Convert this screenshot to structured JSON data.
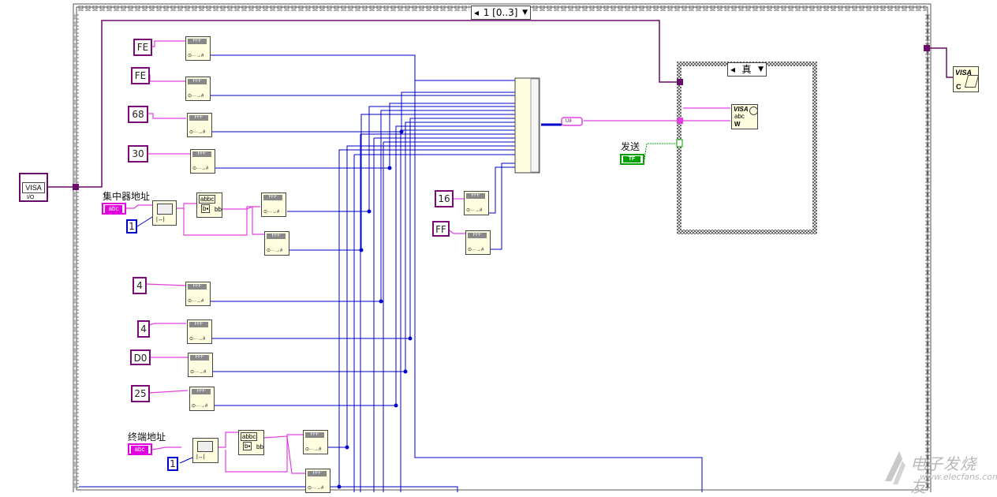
{
  "sequence_selector": {
    "label": "1 [0..3]",
    "arrow": "▼"
  },
  "case_selector": {
    "label": "真",
    "arrow": "▼"
  },
  "labels": {
    "concentrator_address": "集中器地址",
    "terminal_address": "终端地址",
    "send": "发送"
  },
  "string_constants": [
    "FE",
    "FE",
    "68",
    "30",
    "4",
    "4",
    "D0",
    "25",
    "16",
    "FF"
  ],
  "numeric_constants": [
    "1",
    "1"
  ],
  "string_controls": [
    "abc",
    "abc"
  ],
  "visa": {
    "in_label": "VISA",
    "in_sub": "I/O",
    "write_label": "VISA",
    "write_sub": "abc",
    "write_w": "W",
    "close_label": "VISA",
    "close_c": "C"
  },
  "boolean_indicator": {
    "label": "TF"
  },
  "conversion": {
    "u8_label": "U8"
  },
  "node_text": {
    "fmt_top": "FFF",
    "fmt_bottom": "⊙···→#"
  },
  "colors": {
    "wire_visa": "#6a0a6a",
    "wire_string": "#e040e0",
    "wire_numeric": "#0000cc",
    "wire_bool": "#00a000",
    "structure_border": "#7a7a7a",
    "string_const": "#e000e0"
  },
  "watermark": {
    "cn": "电子发烧友",
    "en": "www.elecfans.com"
  }
}
